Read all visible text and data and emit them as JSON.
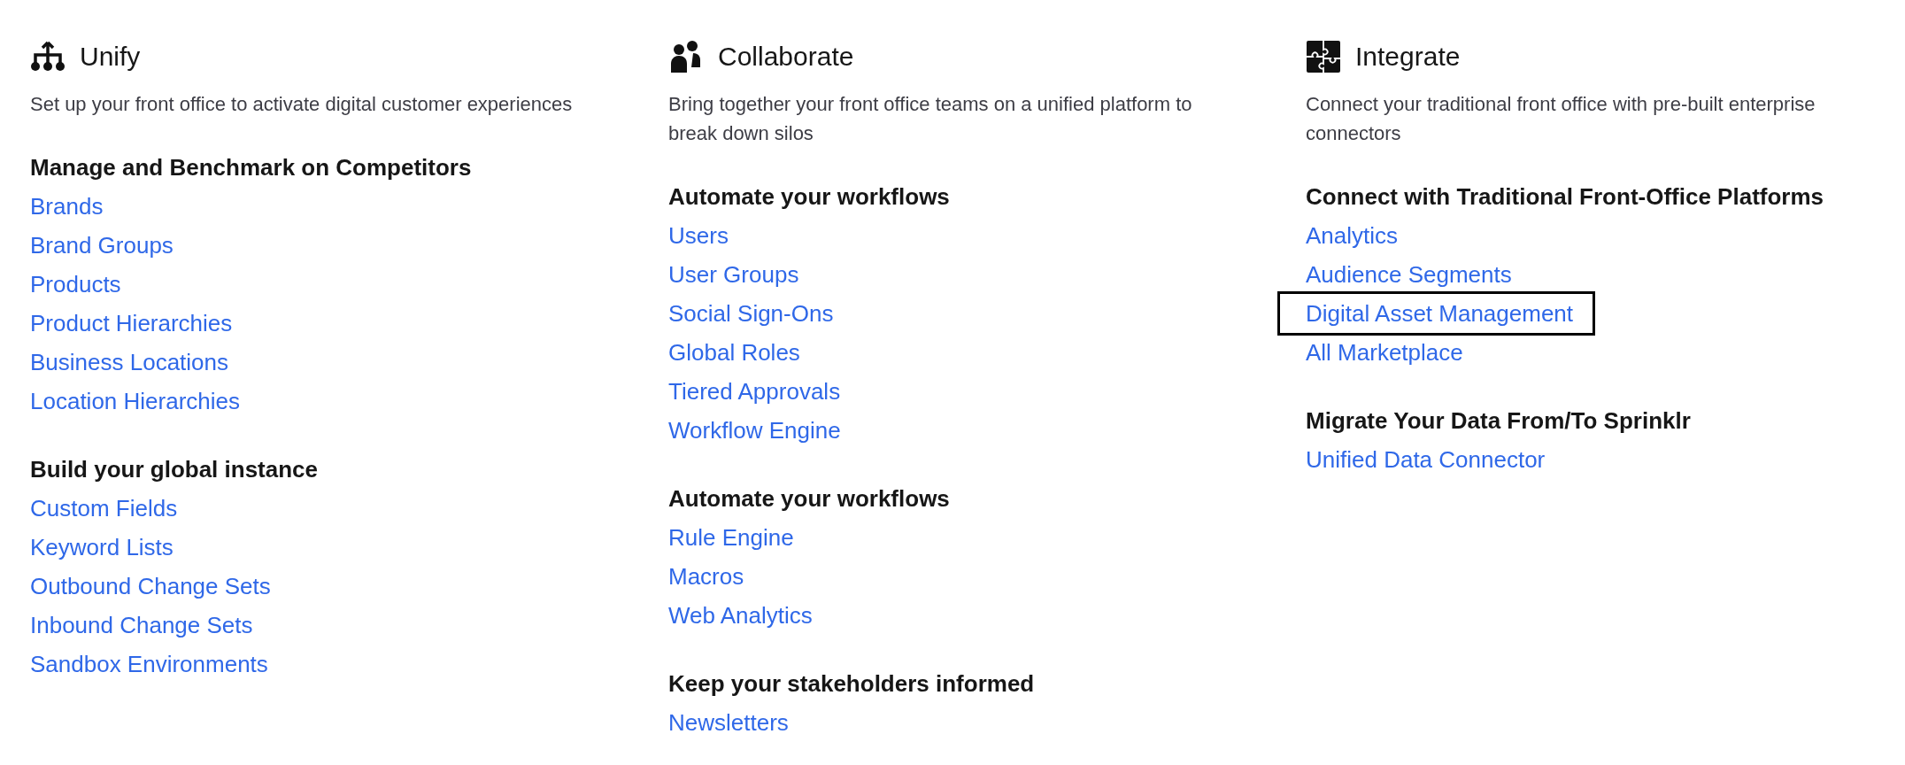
{
  "columns": [
    {
      "kind": "hierarchy",
      "title": "Unify",
      "description": "Set up your front office to activate digital customer experiences",
      "sections": [
        {
          "heading": "Manage and Benchmark on Competitors",
          "links": [
            {
              "label": "Brands",
              "highlighted": false
            },
            {
              "label": "Brand Groups",
              "highlighted": false
            },
            {
              "label": "Products",
              "highlighted": false
            },
            {
              "label": "Product Hierarchies",
              "highlighted": false
            },
            {
              "label": "Business Locations",
              "highlighted": false
            },
            {
              "label": "Location Hierarchies",
              "highlighted": false
            }
          ]
        },
        {
          "heading": "Build your global instance",
          "links": [
            {
              "label": "Custom Fields",
              "highlighted": false
            },
            {
              "label": "Keyword Lists",
              "highlighted": false
            },
            {
              "label": "Outbound Change Sets",
              "highlighted": false
            },
            {
              "label": "Inbound Change Sets",
              "highlighted": false
            },
            {
              "label": "Sandbox Environments",
              "highlighted": false
            }
          ]
        }
      ]
    },
    {
      "kind": "people",
      "title": "Collaborate",
      "description": "Bring together your front office teams on a unified platform to break down silos",
      "sections": [
        {
          "heading": "Automate your workflows",
          "links": [
            {
              "label": "Users",
              "highlighted": false
            },
            {
              "label": "User Groups",
              "highlighted": false
            },
            {
              "label": "Social Sign-Ons",
              "highlighted": false
            },
            {
              "label": "Global Roles",
              "highlighted": false
            },
            {
              "label": "Tiered Approvals",
              "highlighted": false
            },
            {
              "label": "Workflow Engine",
              "highlighted": false
            }
          ]
        },
        {
          "heading": "Automate your workflows",
          "links": [
            {
              "label": "Rule Engine",
              "highlighted": false
            },
            {
              "label": "Macros",
              "highlighted": false
            },
            {
              "label": "Web Analytics",
              "highlighted": false
            }
          ]
        },
        {
          "heading": "Keep your stakeholders informed",
          "links": [
            {
              "label": "Newsletters",
              "highlighted": false
            }
          ]
        }
      ]
    },
    {
      "kind": "puzzle",
      "title": "Integrate",
      "description": "Connect your traditional front office with pre-built enterprise connectors",
      "sections": [
        {
          "heading": "Connect with Traditional Front-Office Platforms",
          "links": [
            {
              "label": "Analytics",
              "highlighted": false
            },
            {
              "label": "Audience Segments",
              "highlighted": false
            },
            {
              "label": "Digital Asset Management",
              "highlighted": true
            },
            {
              "label": "All Marketplace",
              "highlighted": false
            }
          ]
        },
        {
          "heading": "Migrate Your Data From/To Sprinklr",
          "links": [
            {
              "label": "Unified Data Connector",
              "highlighted": false
            }
          ]
        }
      ]
    }
  ]
}
